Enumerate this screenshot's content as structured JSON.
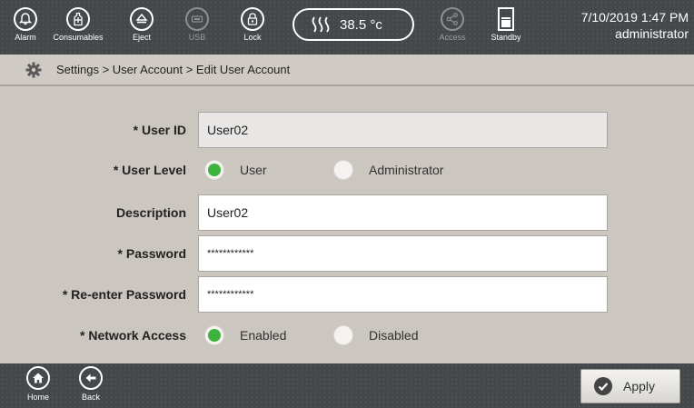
{
  "topbar": {
    "buttons": [
      {
        "label": "Alarm",
        "icon": "bell-icon"
      },
      {
        "label": "Consumables",
        "icon": "bottle-icon"
      },
      {
        "label": "Eject",
        "icon": "eject-icon"
      },
      {
        "label": "USB",
        "icon": "usb-icon",
        "disabled": true
      },
      {
        "label": "Lock",
        "icon": "lock-icon"
      },
      {
        "label": "Access",
        "icon": "share-icon",
        "disabled": true
      },
      {
        "label": "Standby",
        "icon": "standby-icon"
      }
    ],
    "temperature": "38.5 °c",
    "datetime": "7/10/2019 1:47 PM",
    "user": "administrator"
  },
  "breadcrumb": "Settings > User Account > Edit User Account",
  "form": {
    "user_id": {
      "label": "* User ID",
      "value": "User02"
    },
    "user_level": {
      "label": "* User Level",
      "options": [
        "User",
        "Administrator"
      ],
      "selected": "User"
    },
    "description": {
      "label": "Description",
      "value": "User02"
    },
    "password": {
      "label": "* Password",
      "value": "************"
    },
    "reenter_password": {
      "label": "* Re-enter Password",
      "value": "************"
    },
    "network_access": {
      "label": "* Network Access",
      "options": [
        "Enabled",
        "Disabled"
      ],
      "selected": "Enabled"
    }
  },
  "bottombar": {
    "home_label": "Home",
    "back_label": "Back",
    "apply_label": "Apply"
  },
  "colors": {
    "bar_bg": "#44484a",
    "content_bg": "#cbc6bf",
    "radio_selected": "#3db23c"
  }
}
